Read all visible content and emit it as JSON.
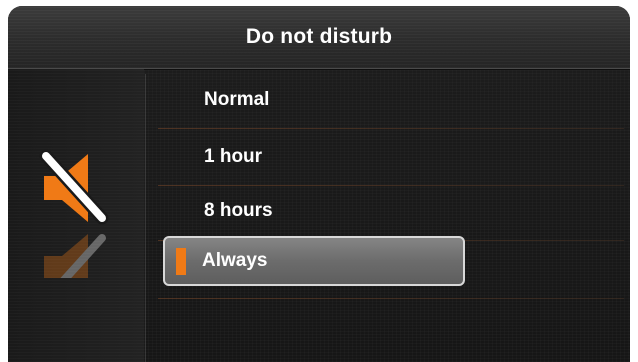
{
  "header": {
    "title": "Do not disturb"
  },
  "icon": {
    "name": "speaker-muted-icon",
    "accent_color": "#f07a16"
  },
  "menu": {
    "selected_index": 3,
    "items": [
      {
        "label": "Normal"
      },
      {
        "label": "1 hour"
      },
      {
        "label": "8 hours"
      },
      {
        "label": "Always"
      }
    ]
  }
}
